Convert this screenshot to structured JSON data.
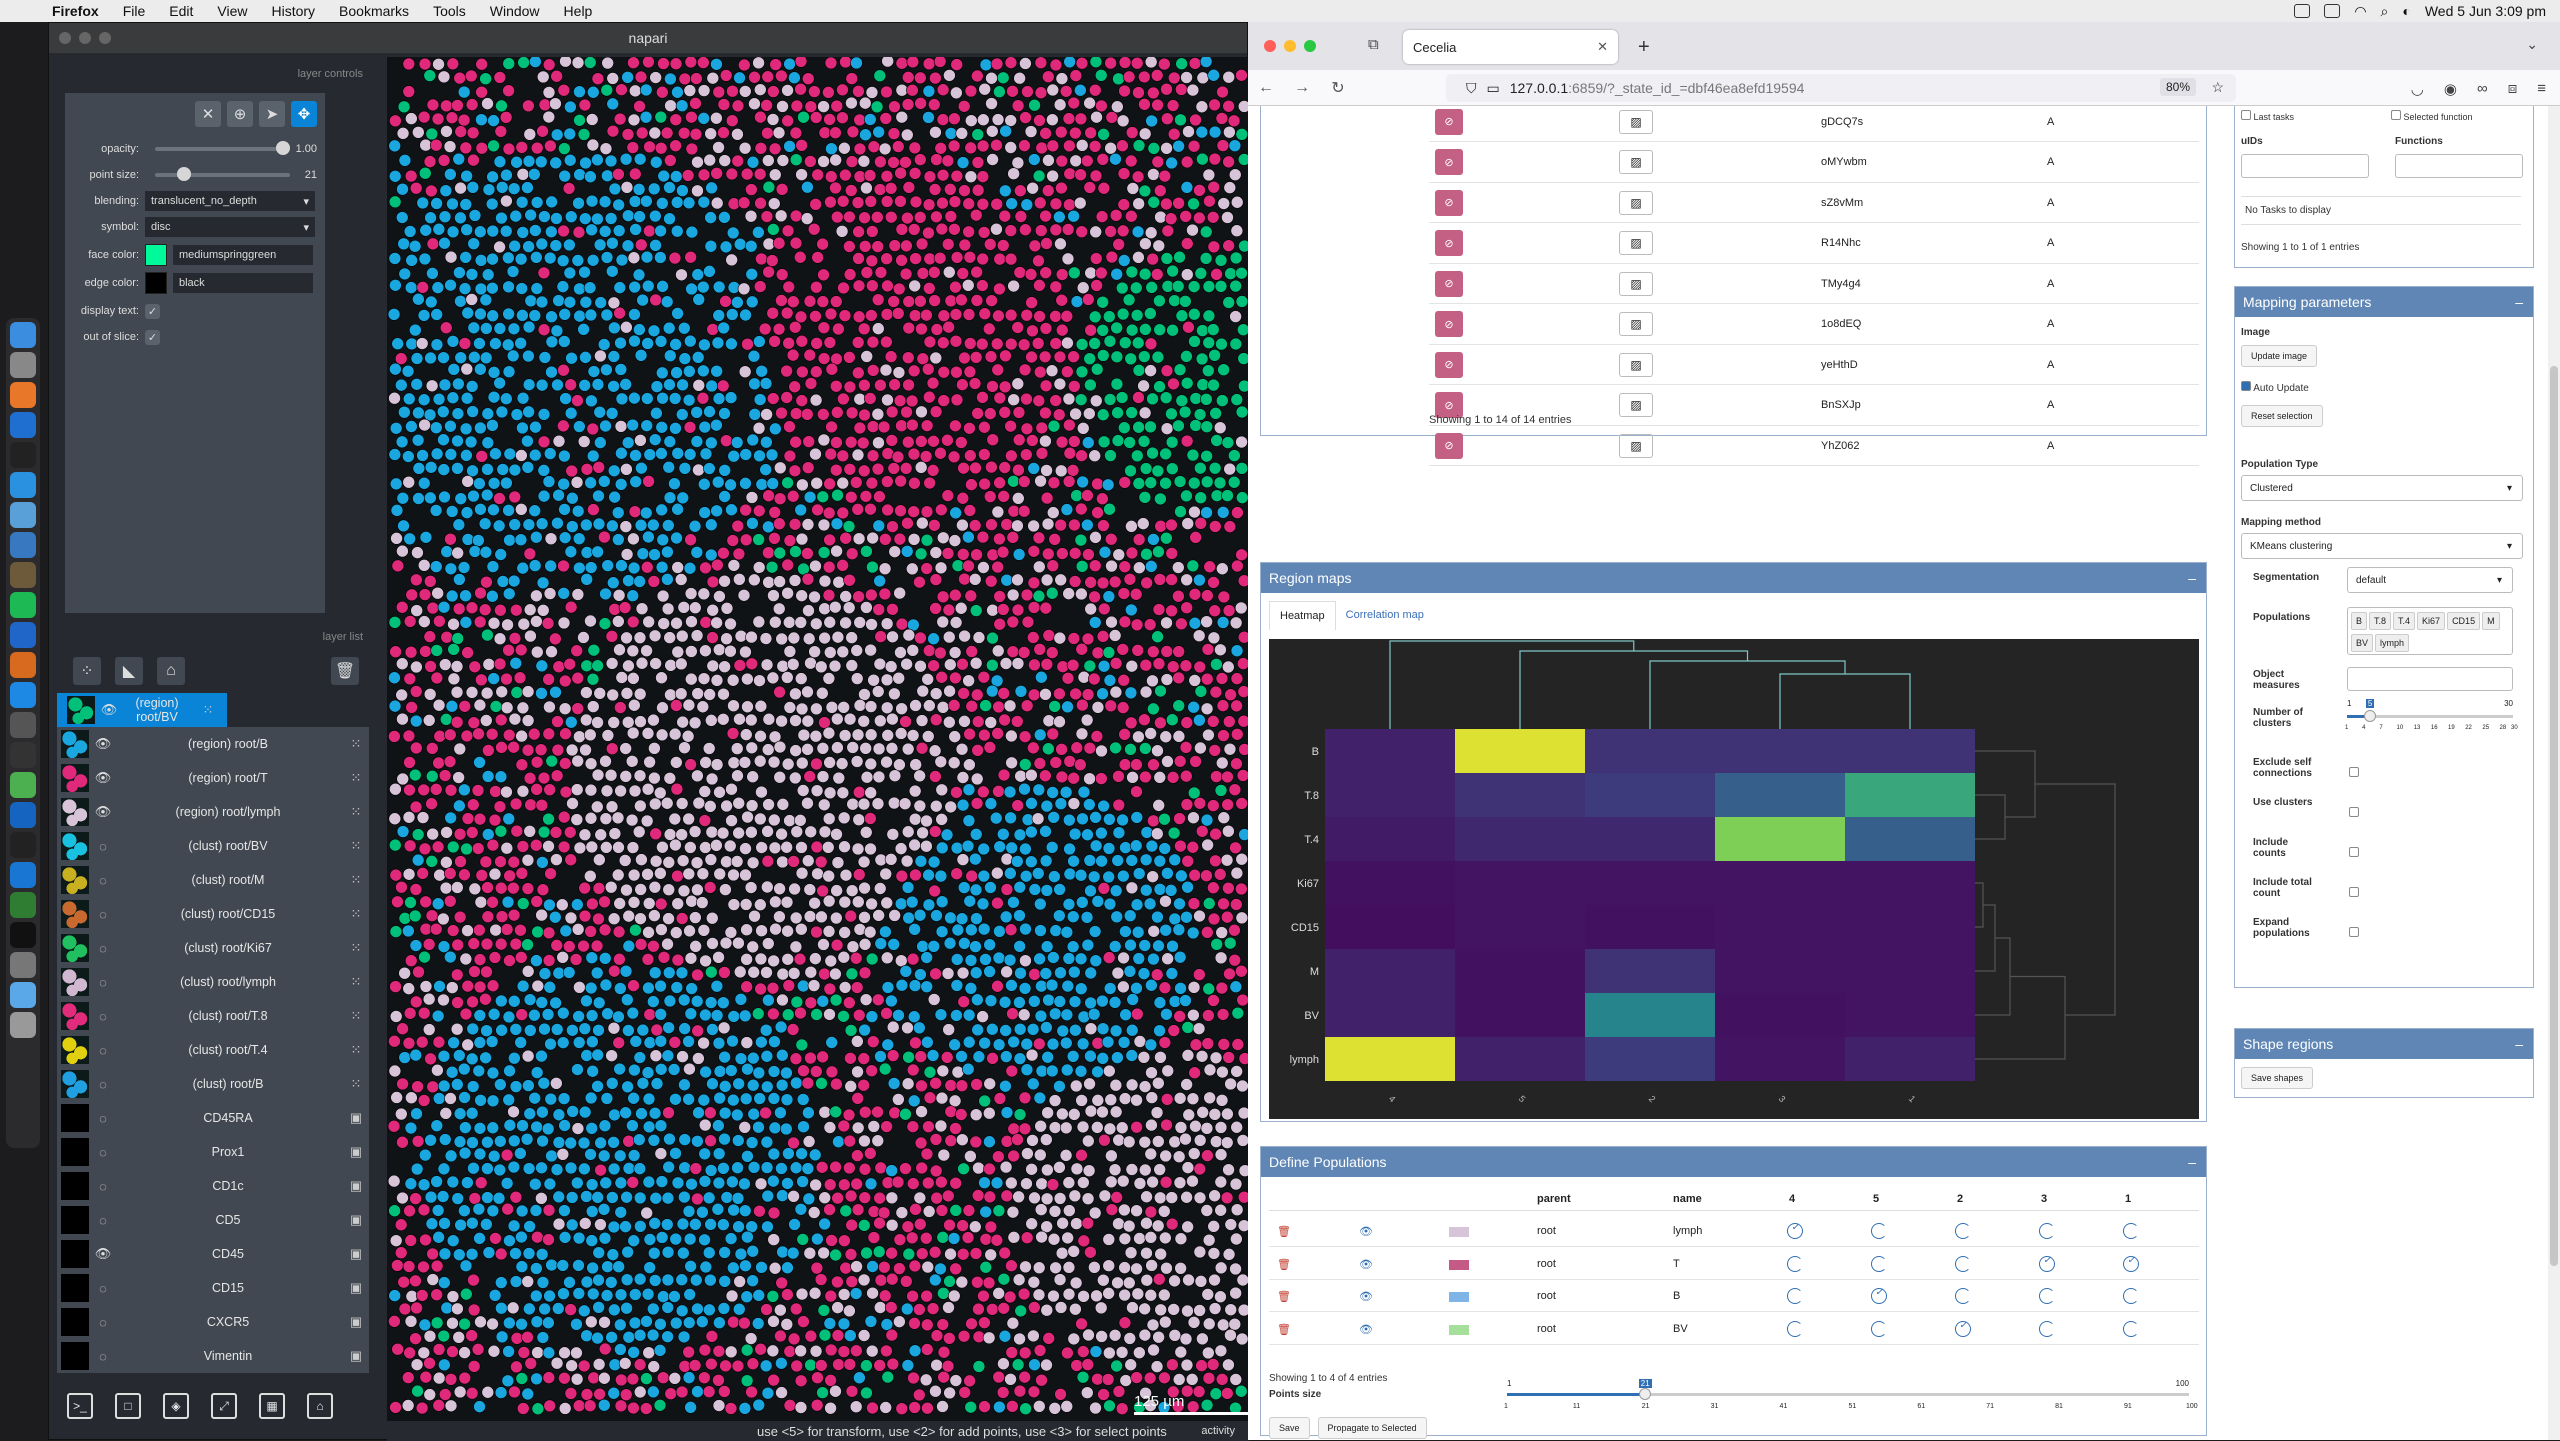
{
  "menubar": {
    "app": "Firefox",
    "items": [
      "File",
      "Edit",
      "View",
      "History",
      "Bookmarks",
      "Tools",
      "Window",
      "Help"
    ],
    "clock": "Wed 5 Jun  3:09 pm"
  },
  "napari": {
    "title": "napari",
    "layer_controls_label": "layer controls",
    "layer_list_label": "layer list",
    "controls": {
      "opacity_label": "opacity:",
      "opacity_value": "1.00",
      "opacity_level": 1.0,
      "point_size_label": "point size:",
      "point_size_value": "21",
      "point_size_level": 0.18,
      "blending_label": "blending:",
      "blending_value": "translucent_no_depth",
      "symbol_label": "symbol:",
      "symbol_value": "disc",
      "face_color_label": "face color:",
      "face_color_value": "mediumspringgreen",
      "face_color_hex": "#00fa9a",
      "edge_color_label": "edge color:",
      "edge_color_value": "black",
      "edge_color_hex": "#000000",
      "display_text_label": "display text:",
      "out_of_slice_label": "out of slice:"
    },
    "layers": [
      {
        "name": "(region) root/BV",
        "visible": true,
        "selected": true,
        "kind": "points",
        "thumb": "#00c07a"
      },
      {
        "name": "(region) root/B",
        "visible": true,
        "selected": false,
        "kind": "points",
        "thumb": "#1aa7e0"
      },
      {
        "name": "(region) root/T",
        "visible": true,
        "selected": false,
        "kind": "points",
        "thumb": "#e0297a"
      },
      {
        "name": "(region) root/lymph",
        "visible": true,
        "selected": false,
        "kind": "points",
        "thumb": "#d8c4d8"
      },
      {
        "name": "(clust) root/BV",
        "visible": false,
        "selected": false,
        "kind": "points",
        "thumb": "#19c0e0"
      },
      {
        "name": "(clust) root/M",
        "visible": false,
        "selected": false,
        "kind": "points",
        "thumb": "#c8b020"
      },
      {
        "name": "(clust) root/CD15",
        "visible": false,
        "selected": false,
        "kind": "points",
        "thumb": "#c86a30"
      },
      {
        "name": "(clust) root/Ki67",
        "visible": false,
        "selected": false,
        "kind": "points",
        "thumb": "#20c060"
      },
      {
        "name": "(clust) root/lymph",
        "visible": false,
        "selected": false,
        "kind": "points",
        "thumb": "#d0b8d0"
      },
      {
        "name": "(clust) root/T.8",
        "visible": false,
        "selected": false,
        "kind": "points",
        "thumb": "#e02c7a"
      },
      {
        "name": "(clust) root/T.4",
        "visible": false,
        "selected": false,
        "kind": "points",
        "thumb": "#e0d010"
      },
      {
        "name": "(clust) root/B",
        "visible": false,
        "selected": false,
        "kind": "points",
        "thumb": "#20a0e0"
      },
      {
        "name": "CD45RA",
        "visible": false,
        "selected": false,
        "kind": "image",
        "thumb": "#000000"
      },
      {
        "name": "Prox1",
        "visible": false,
        "selected": false,
        "kind": "image",
        "thumb": "#000000"
      },
      {
        "name": "CD1c",
        "visible": false,
        "selected": false,
        "kind": "image",
        "thumb": "#000000"
      },
      {
        "name": "CD5",
        "visible": false,
        "selected": false,
        "kind": "image",
        "thumb": "#000000"
      },
      {
        "name": "CD45",
        "visible": true,
        "selected": false,
        "kind": "image",
        "thumb": "#000000"
      },
      {
        "name": "CD15",
        "visible": false,
        "selected": false,
        "kind": "image",
        "thumb": "#000000"
      },
      {
        "name": "CXCR5",
        "visible": false,
        "selected": false,
        "kind": "image",
        "thumb": "#000000"
      },
      {
        "name": "Vimentin",
        "visible": false,
        "selected": false,
        "kind": "image",
        "thumb": "#000000"
      }
    ],
    "scale_bar": "125 µm",
    "status": "use <5> for transform, use <2> for add points, use <3> for select points",
    "activity": "activity"
  },
  "browser": {
    "tab_title": "Cecelia",
    "url_host": "127.0.0.1",
    "url_path": ":6859/?_state_id_=dbf46ea8efd19594",
    "zoom": "80%",
    "tasks": {
      "rows": [
        {
          "uid": "gDCQ7s",
          "fn": "A"
        },
        {
          "uid": "oMYwbm",
          "fn": "A"
        },
        {
          "uid": "sZ8vMm",
          "fn": "A"
        },
        {
          "uid": "R14Nhc",
          "fn": "A"
        },
        {
          "uid": "TMy4g4",
          "fn": "A"
        },
        {
          "uid": "1o8dEQ",
          "fn": "A"
        },
        {
          "uid": "yeHthD",
          "fn": "A"
        },
        {
          "uid": "BnSXJp",
          "fn": "A"
        },
        {
          "uid": "YhZ062",
          "fn": "A"
        }
      ],
      "footer": "Showing 1 to 14 of 14 entries"
    },
    "right_top": {
      "last_tasks": "Last tasks",
      "selected_function": "Selected function",
      "uids_label": "uIDs",
      "functions_label": "Functions",
      "empty": "No Tasks to display",
      "footer": "Showing 1 to 1 of 1 entries"
    },
    "mapping": {
      "title": "Mapping parameters",
      "image_label": "Image",
      "update_image": "Update image",
      "auto_update": "Auto Update",
      "reset_selection": "Reset selection",
      "population_type_label": "Population Type",
      "population_type": "Clustered",
      "mapping_method_label": "Mapping method",
      "mapping_method": "KMeans clustering",
      "segmentation_label": "Segmentation",
      "segmentation": "default",
      "populations_label": "Populations",
      "populations": [
        "B",
        "T.8",
        "T.4",
        "Ki67",
        "CD15",
        "M",
        "BV",
        "lymph"
      ],
      "object_measures_label": "Object measures",
      "n_clusters_label": "Number of clusters",
      "n_clusters_min": "1",
      "n_clusters_max": "30",
      "n_clusters_value": "5",
      "n_clusters_ticks": [
        "1",
        "4",
        "7",
        "10",
        "13",
        "16",
        "19",
        "22",
        "25",
        "28",
        "30"
      ],
      "exclude_self_label": "Exclude self connections",
      "use_clusters_label": "Use clusters",
      "include_counts_label": "Include counts",
      "include_total_label": "Include total count",
      "expand_pops_label": "Expand populations"
    },
    "shape_regions": {
      "title": "Shape regions",
      "save": "Save shapes"
    },
    "region_maps": {
      "title": "Region maps",
      "tab_heatmap": "Heatmap",
      "tab_corr": "Correlation map"
    },
    "define_pops": {
      "title": "Define Populations",
      "cols": [
        "parent",
        "name",
        "4",
        "5",
        "2",
        "3",
        "1"
      ],
      "rows": [
        {
          "parent": "root",
          "name": "lymph",
          "color": "#d8c4d8",
          "checks": [
            true,
            false,
            false,
            false,
            false
          ]
        },
        {
          "parent": "root",
          "name": "T",
          "color": "#c45b86",
          "checks": [
            false,
            false,
            false,
            true,
            true
          ]
        },
        {
          "parent": "root",
          "name": "B",
          "color": "#7fb5e6",
          "checks": [
            false,
            true,
            false,
            false,
            false
          ]
        },
        {
          "parent": "root",
          "name": "BV",
          "color": "#a6df9a",
          "checks": [
            false,
            false,
            true,
            false,
            false
          ]
        }
      ],
      "footer": "Showing 1 to 4 of 4 entries",
      "points_size_label": "Points size",
      "points_min": "1",
      "points_max": "100",
      "points_value": "21",
      "points_ticks": [
        "1",
        "11",
        "21",
        "31",
        "41",
        "51",
        "61",
        "71",
        "81",
        "91",
        "100"
      ],
      "save": "Save",
      "propagate": "Propagate to Selected"
    }
  },
  "chart_data": {
    "type": "heatmap",
    "rows": [
      "B",
      "T.8",
      "T.4",
      "Ki67",
      "CD15",
      "M",
      "BV",
      "lymph"
    ],
    "cols": [
      "4",
      "5",
      "2",
      "3",
      "1"
    ],
    "values": [
      [
        0.1,
        0.95,
        0.15,
        0.15,
        0.15
      ],
      [
        0.1,
        0.15,
        0.18,
        0.3,
        0.6
      ],
      [
        0.08,
        0.12,
        0.12,
        0.8,
        0.3
      ],
      [
        0.05,
        0.06,
        0.06,
        0.06,
        0.06
      ],
      [
        0.04,
        0.06,
        0.05,
        0.06,
        0.06
      ],
      [
        0.1,
        0.05,
        0.15,
        0.06,
        0.06
      ],
      [
        0.1,
        0.05,
        0.45,
        0.05,
        0.06
      ],
      [
        0.95,
        0.1,
        0.18,
        0.06,
        0.1
      ]
    ],
    "colormap": "viridis"
  }
}
